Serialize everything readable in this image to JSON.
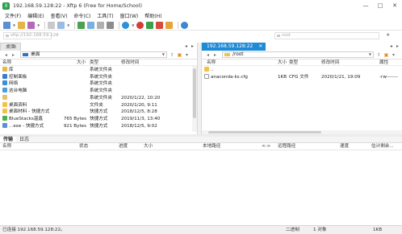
{
  "window": {
    "title": "192.168.59.128:22 - Xftp 6 (Free for Home/School)",
    "controls": [
      "—",
      "□",
      "✕"
    ]
  },
  "menu": [
    "文件(F)",
    "编辑(E)",
    "查看(V)",
    "命令(C)",
    "工具(T)",
    "窗口(W)",
    "帮助(H)"
  ],
  "address": {
    "left_placeholder": "sftp://192.168.59.128",
    "right_placeholder": "root"
  },
  "left_pane": {
    "tab_label": "桌面",
    "tab_close": "✕",
    "path": "桌面",
    "columns": [
      "名称",
      "大小",
      "类型",
      "修改时间"
    ],
    "rows": [
      {
        "name": "库",
        "size": "",
        "type": "系统文件夹",
        "modified": "",
        "icon": "library-icon",
        "color": "#e8b84a"
      },
      {
        "name": "控制面板",
        "size": "",
        "type": "系统文件夹",
        "modified": "",
        "icon": "control-panel-icon",
        "color": "#3a7bd5"
      },
      {
        "name": "网络",
        "size": "",
        "type": "系统文件夹",
        "modified": "",
        "icon": "network-icon",
        "color": "#3a8fd5"
      },
      {
        "name": "这台电脑",
        "size": "",
        "type": "系统文件夹",
        "modified": "",
        "icon": "computer-icon",
        "color": "#4a9ee0"
      },
      {
        "name": "",
        "size": "",
        "type": "系统文件夹",
        "modified": "2020/1/22, 10:20",
        "icon": "user-folder-icon",
        "color": "#e8c06a"
      },
      {
        "name": "桌面资料",
        "size": "",
        "type": "文件夹",
        "modified": "2020/1/20, 9:11",
        "icon": "folder-icon",
        "color": "#f0c24a"
      },
      {
        "name": "桌面材料 - 快捷方式",
        "size": "",
        "type": "快捷方式",
        "modified": "2018/12/5, 8:28",
        "icon": "shortcut-icon",
        "color": "#f0c24a"
      },
      {
        "name": "BlueStacks温鑫",
        "size": "765 Bytes",
        "type": "快捷方式",
        "modified": "2019/11/3, 13:40",
        "icon": "bluestacks-icon",
        "color": "#4caf50"
      },
      {
        "name": "...exe - 快捷方式",
        "size": "921 Bytes",
        "type": "快捷方式",
        "modified": "2018/12/5, 9:02",
        "icon": "exe-shortcut-icon",
        "color": "#5b8ed6"
      }
    ]
  },
  "right_pane": {
    "tab_label": "192.168.59.128:22",
    "tab_close": "✕",
    "path": "/root",
    "columns": [
      "名称",
      "大小",
      "类型",
      "修改时间",
      "属性"
    ],
    "rows": [
      {
        "name": "..",
        "size": "",
        "type": "",
        "modified": "",
        "attrs": "",
        "icon": "parent-folder-icon",
        "color": "#f0c24a"
      },
      {
        "name": "anaconda-ks.cfg",
        "size": "1KB",
        "type": "CFG 文件",
        "modified": "2020/1/21, 19:09",
        "attrs": "-rw-------",
        "icon": "file-icon",
        "color": "#ffffff"
      }
    ]
  },
  "transfer": {
    "tabs": [
      "传输",
      "日志"
    ],
    "columns": [
      "名称",
      "状态",
      "进度",
      "大小",
      "本地路径",
      "<->",
      "远程路径",
      "速度",
      "估计剩余..."
    ]
  },
  "status": {
    "connection": "已连接 192.168.59.128:22。",
    "mode": "二进制",
    "objects": "1 对象",
    "size": "1KB"
  }
}
